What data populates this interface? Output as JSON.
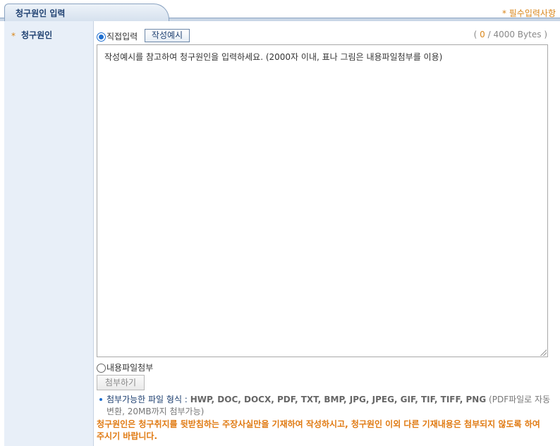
{
  "header": {
    "tab_title": "청구원인 입력",
    "required_note": "* 필수입력사항"
  },
  "label": {
    "star": "*",
    "text": "청구원인"
  },
  "input_mode": {
    "direct_label": "직접입력",
    "direct_selected": true,
    "example_button": "작성예시",
    "file_label": "내용파일첨부",
    "file_selected": false
  },
  "bytes": {
    "open": "(",
    "current": "0",
    "separator": "/",
    "max": "4000 Bytes",
    "close": ")"
  },
  "textarea": {
    "placeholder": "작성예시를 참고하여 청구원인을 입력하세요. (2000자 이내, 표나 그림은 내용파일첨부를 이용)"
  },
  "attach_button": "첨부하기",
  "info": {
    "key": "첨부가능한 파일 형식 :",
    "formats": "HWP, DOC, DOCX, PDF, TXT, BMP, JPG, JPEG, GIF, TIF, TIFF, PNG",
    "note": "(PDF파일로 자동변환, 20MB까지 첨부가능)"
  },
  "warning": "청구원인은 청구취지를 뒷받침하는 주장사실만을 기재하여 작성하시고, 청구원인 이외 다른 기재내용은 첨부되지 않도록 하여 주시기 바랍니다.",
  "colors": {
    "accent_blue": "#1d3f70",
    "accent_orange": "#d9861a",
    "label_bg": "#e8eff8"
  }
}
